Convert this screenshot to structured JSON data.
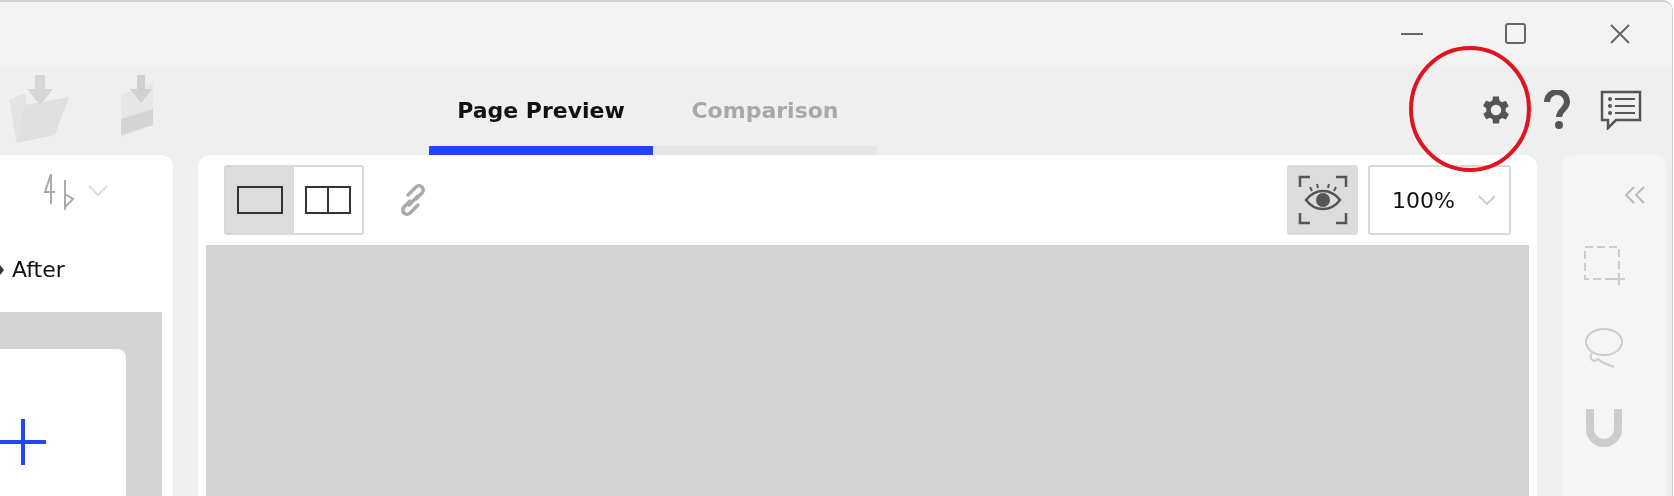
{
  "tabs": [
    {
      "label": "Page Preview",
      "selected": true
    },
    {
      "label": "Comparison",
      "selected": false
    }
  ],
  "left_panel": {
    "label": "After"
  },
  "view_modes": [
    {
      "kind": "single",
      "selected": true
    },
    {
      "kind": "split",
      "selected": false
    }
  ],
  "eye_toggle": {
    "on": true
  },
  "zoom": {
    "value": "100%"
  }
}
